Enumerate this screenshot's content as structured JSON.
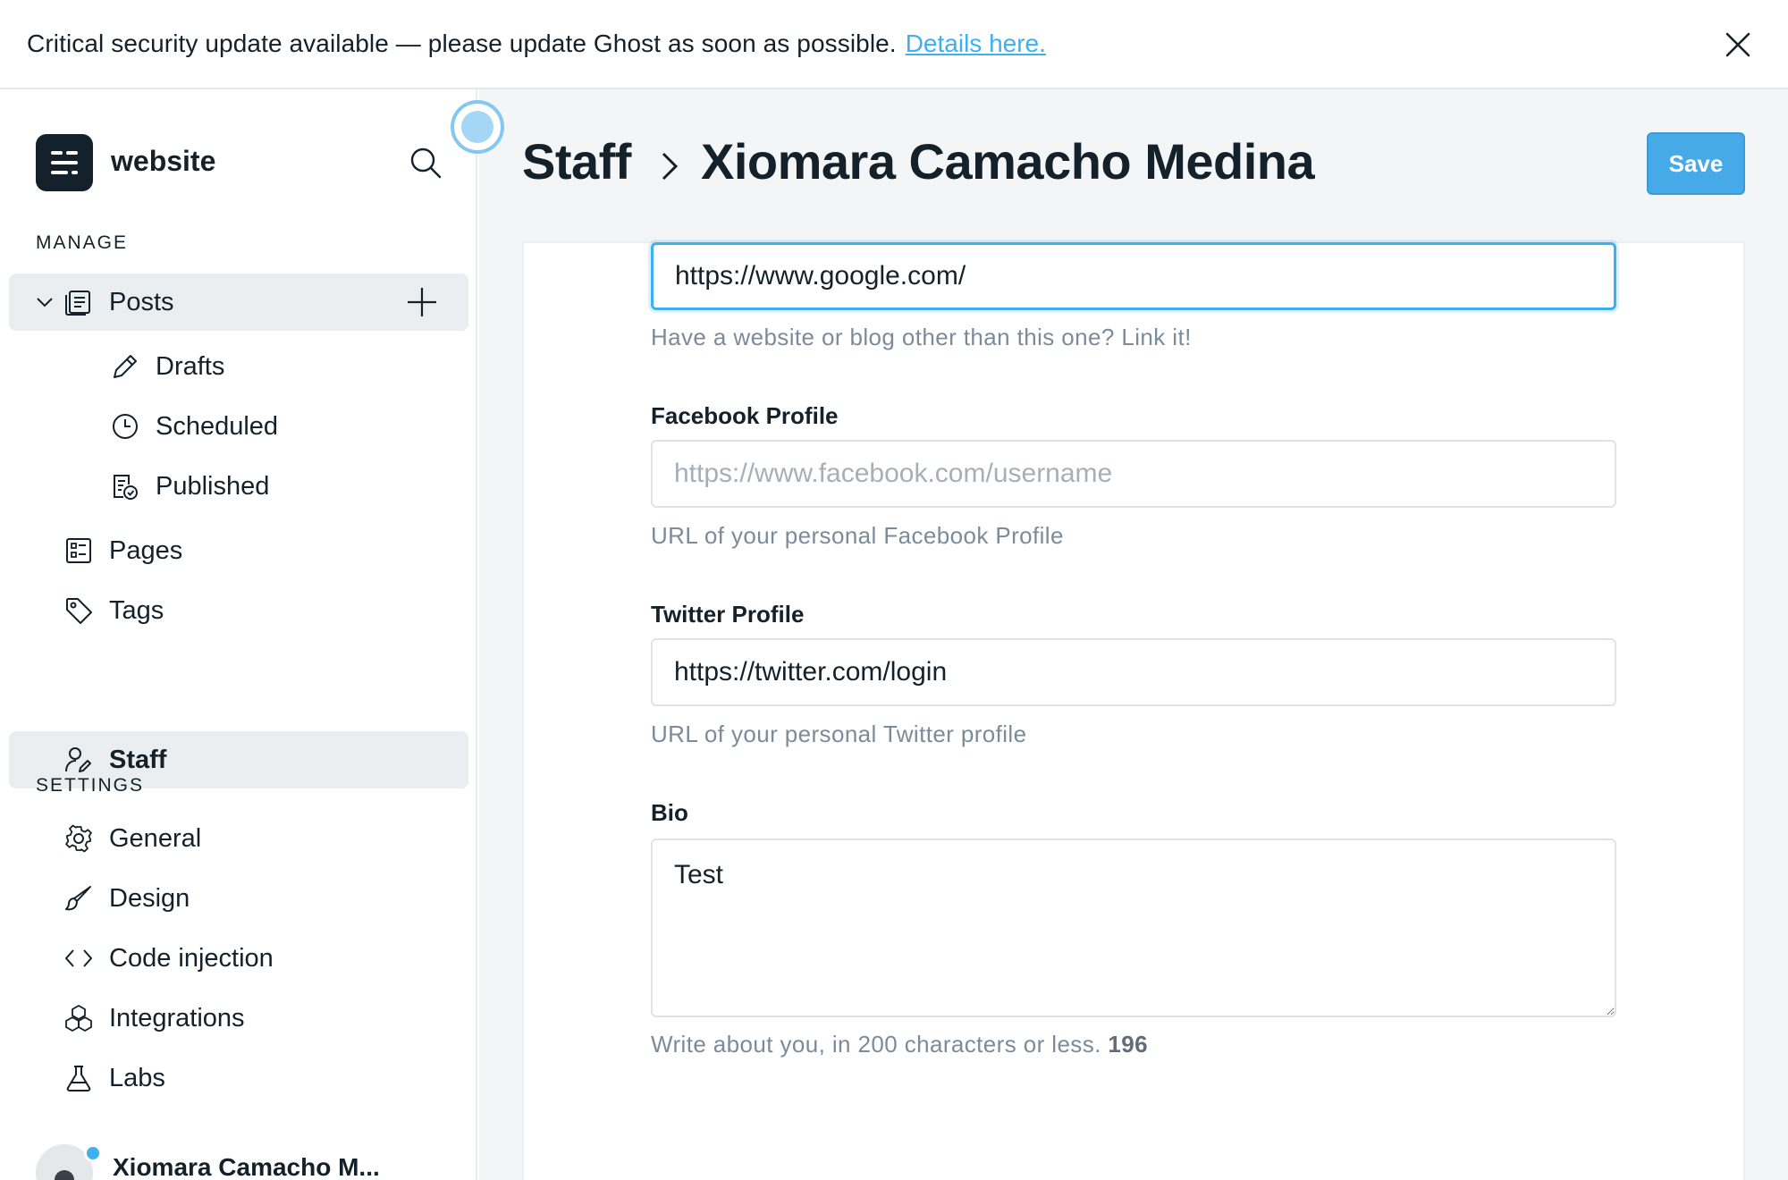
{
  "banner": {
    "message": "Critical security update available — please update Ghost as soon as possible.",
    "link_text": "Details here."
  },
  "sidebar": {
    "site_name": "website",
    "manage_label": "MANAGE",
    "posts_label": "Posts",
    "post_subitems": [
      {
        "label": "Drafts",
        "icon": "pencil-icon"
      },
      {
        "label": "Scheduled",
        "icon": "clock-icon"
      },
      {
        "label": "Published",
        "icon": "published-icon"
      }
    ],
    "manage_items": [
      {
        "label": "Pages",
        "icon": "pages-icon"
      },
      {
        "label": "Tags",
        "icon": "tag-icon"
      },
      {
        "label": "Staff",
        "icon": "staff-icon"
      }
    ],
    "settings_label": "SETTINGS",
    "settings_items": [
      {
        "label": "General",
        "icon": "gear-icon"
      },
      {
        "label": "Design",
        "icon": "brush-icon"
      },
      {
        "label": "Code injection",
        "icon": "code-icon"
      },
      {
        "label": "Integrations",
        "icon": "integrations-icon"
      },
      {
        "label": "Labs",
        "icon": "flask-icon"
      }
    ],
    "user_name": "Xiomara Camacho M..."
  },
  "header": {
    "breadcrumb_parent": "Staff",
    "title": "Xiomara Camacho Medina",
    "save_label": "Save"
  },
  "form": {
    "website": {
      "value": "https://www.google.com/",
      "hint": "Have a website or blog other than this one? Link it!"
    },
    "facebook": {
      "label": "Facebook Profile",
      "value": "",
      "placeholder": "https://www.facebook.com/username",
      "hint": "URL of your personal Facebook Profile"
    },
    "twitter": {
      "label": "Twitter Profile",
      "value": "https://twitter.com/login",
      "hint": "URL of your personal Twitter profile"
    },
    "bio": {
      "label": "Bio",
      "value": "Test",
      "hint": "Write about you, in 200 characters or less.",
      "remaining": "196"
    }
  },
  "colors": {
    "accent": "#3eb0ef",
    "save_button": "#46a9e8",
    "text": "#15212a",
    "hint": "#7c8b9a",
    "active_nav_bg": "#ebeef0"
  }
}
